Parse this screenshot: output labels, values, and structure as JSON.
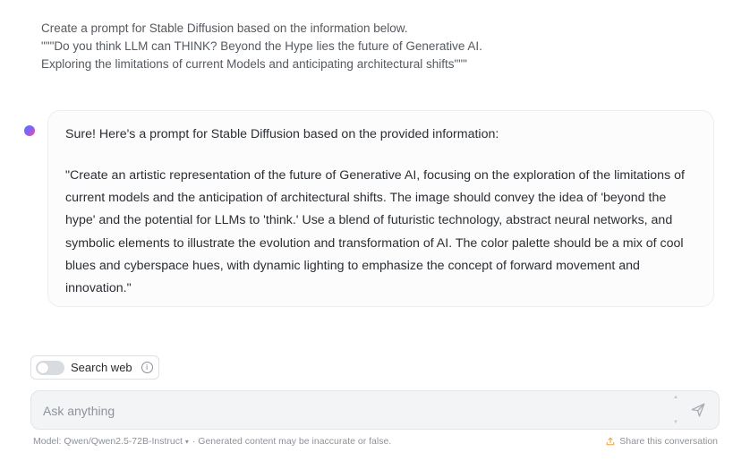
{
  "user_message": {
    "lines": [
      "Create a prompt for Stable Diffusion based on the information below.",
      "\"\"\"Do you think LLM can THINK? Beyond the Hype lies the future of Generative AI.",
      "Exploring the limitations of current Models and anticipating architectural shifts\"\"\""
    ]
  },
  "assistant_message": {
    "intro": "Sure! Here's a prompt for Stable Diffusion based on the provided information:",
    "body": "\"Create an artistic representation of the future of Generative AI, focusing on the exploration of the limitations of current models and the anticipation of architectural shifts. The image should convey the idea of 'beyond the hype' and the potential for LLMs to 'think.' Use a blend of futuristic technology, abstract neural networks, and symbolic elements to illustrate the evolution and transformation of AI. The color palette should be a mix of cool blues and cyberspace hues, with dynamic lighting to emphasize the concept of forward movement and innovation.\""
  },
  "search_web": {
    "label": "Search web",
    "enabled": false,
    "info_icon": "info-icon"
  },
  "input": {
    "placeholder": "Ask anything",
    "value": ""
  },
  "footer": {
    "model_label": "Model: Qwen/Qwen2.5-72B-Instruct",
    "caret": "▾",
    "disclaimer": "· Generated content may be inaccurate or false.",
    "share_label": "Share this conversation",
    "share_icon": "share-icon"
  },
  "colors": {
    "accent_share": "#f0a040",
    "background": "#ffffff",
    "card_border": "#eceef1",
    "input_bg": "#f3f4f6"
  }
}
